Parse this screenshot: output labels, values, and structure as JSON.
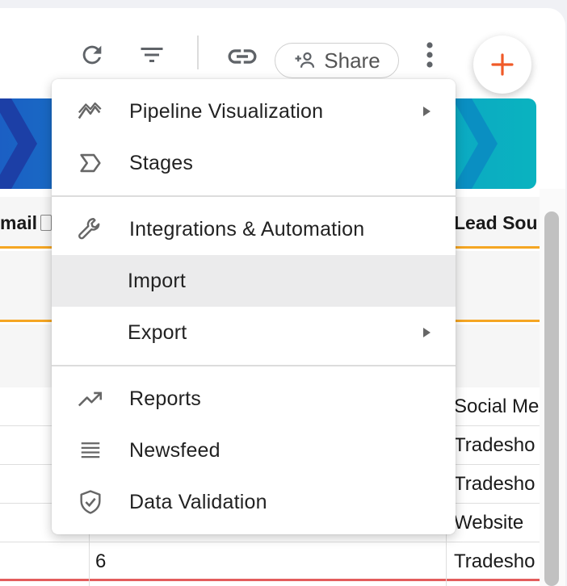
{
  "toolbar": {
    "refresh_icon": "refresh-icon",
    "filter_icon": "filter-icon",
    "link_icon": "link-icon",
    "share_icon": "add-person-icon",
    "share_label": "Share",
    "more_icon": "more-vert-icon",
    "add_icon": "plus-icon"
  },
  "colors": {
    "accent_orange": "#f5a623",
    "fab_plus": "#f05a28",
    "banner_start": "#1b5fc4",
    "banner_end": "#0ab3c0",
    "hover_bg": "#ebebec"
  },
  "table": {
    "headers": {
      "email": "mail",
      "lead_source": "Lead Sou"
    },
    "rows": [
      {
        "number": "",
        "lead_source": "Social Me"
      },
      {
        "number": "",
        "lead_source": "Tradesho"
      },
      {
        "number": "",
        "lead_source": "Tradesho"
      },
      {
        "number": "",
        "lead_source": "Website"
      },
      {
        "number": "6",
        "lead_source": "Tradesho"
      }
    ]
  },
  "menu": {
    "groups": [
      [
        {
          "label": "Pipeline Visualization",
          "icon": "pipeline-icon",
          "submenu": true
        },
        {
          "label": "Stages",
          "icon": "stages-icon",
          "submenu": false
        }
      ],
      [
        {
          "label": "Integrations & Automation",
          "icon": "wrench-icon",
          "submenu": false
        },
        {
          "label": "Import",
          "icon": "",
          "submenu": false,
          "hovered": true
        },
        {
          "label": "Export",
          "icon": "",
          "submenu": true
        }
      ],
      [
        {
          "label": "Reports",
          "icon": "trending-up-icon",
          "submenu": false
        },
        {
          "label": "Newsfeed",
          "icon": "list-lines-icon",
          "submenu": false
        },
        {
          "label": "Data Validation",
          "icon": "shield-check-icon",
          "submenu": false
        }
      ]
    ]
  }
}
